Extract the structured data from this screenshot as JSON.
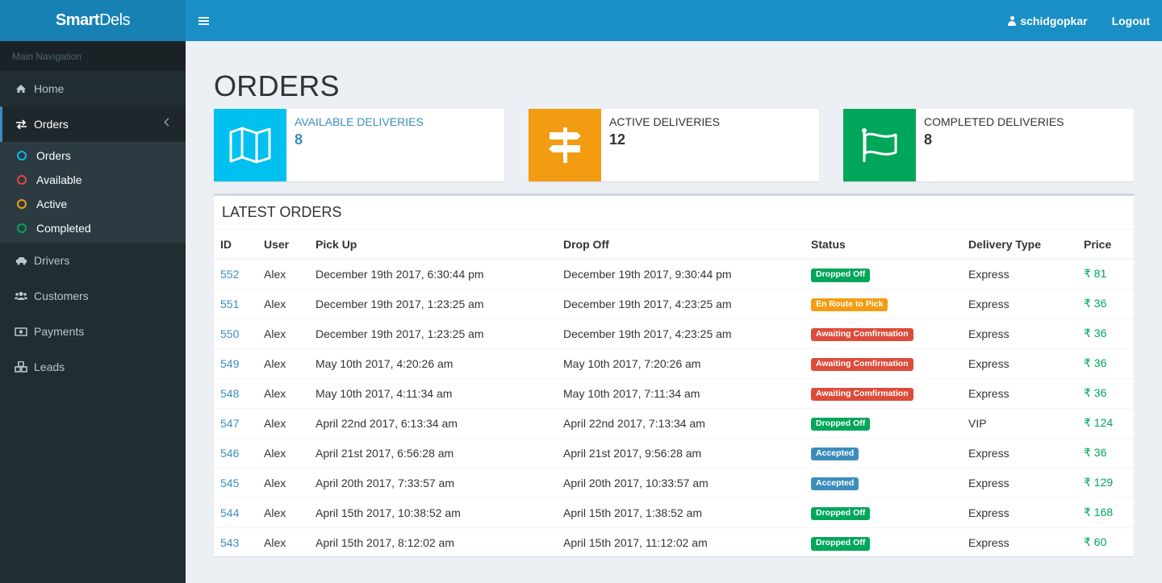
{
  "header": {
    "logo_bold": "Smart",
    "logo_light": "Dels",
    "username": "schidgopkar",
    "logout_label": "Logout"
  },
  "sidebar": {
    "nav_header": "Main Navigation",
    "items": [
      {
        "label": "Home",
        "icon": "home-icon"
      },
      {
        "label": "Orders",
        "icon": "exchange-icon"
      },
      {
        "label": "Drivers",
        "icon": "car-icon"
      },
      {
        "label": "Customers",
        "icon": "users-icon"
      },
      {
        "label": "Payments",
        "icon": "money-icon"
      },
      {
        "label": "Leads",
        "icon": "cubes-icon"
      }
    ],
    "orders_subitems": [
      {
        "label": "Orders",
        "color": "#00c0ef"
      },
      {
        "label": "Available",
        "color": "#dd4b39"
      },
      {
        "label": "Active",
        "color": "#f39c12"
      },
      {
        "label": "Completed",
        "color": "#00a65a"
      }
    ]
  },
  "page": {
    "title": "ORDERS"
  },
  "info_boxes": [
    {
      "label": "AVAILABLE DELIVERIES",
      "value": "8",
      "color": "#00c0ef",
      "icon": "map-icon"
    },
    {
      "label": "ACTIVE DELIVERIES",
      "value": "12",
      "color": "#f39c12",
      "icon": "signpost-icon"
    },
    {
      "label": "COMPLETED DELIVERIES",
      "value": "8",
      "color": "#00a65a",
      "icon": "flag-icon"
    }
  ],
  "latest_orders": {
    "title": "LATEST ORDERS",
    "columns": [
      "ID",
      "User",
      "Pick Up",
      "Drop Off",
      "Status",
      "Delivery Type",
      "Price"
    ],
    "rows": [
      {
        "id": "552",
        "user": "Alex",
        "pickup": "December 19th 2017, 6:30:44 pm",
        "dropoff": "December 19th 2017, 9:30:44 pm",
        "status": "Dropped Off",
        "status_color": "#00a65a",
        "type": "Express",
        "price": "₹ 81"
      },
      {
        "id": "551",
        "user": "Alex",
        "pickup": "December 19th 2017, 1:23:25 am",
        "dropoff": "December 19th 2017, 4:23:25 am",
        "status": "En Route to Pick",
        "status_color": "#f39c12",
        "type": "Express",
        "price": "₹ 36"
      },
      {
        "id": "550",
        "user": "Alex",
        "pickup": "December 19th 2017, 1:23:25 am",
        "dropoff": "December 19th 2017, 4:23:25 am",
        "status": "Awaiting Comfirmation",
        "status_color": "#dd4b39",
        "type": "Express",
        "price": "₹ 36"
      },
      {
        "id": "549",
        "user": "Alex",
        "pickup": "May 10th 2017, 4:20:26 am",
        "dropoff": "May 10th 2017, 7:20:26 am",
        "status": "Awaiting Comfirmation",
        "status_color": "#dd4b39",
        "type": "Express",
        "price": "₹ 36"
      },
      {
        "id": "548",
        "user": "Alex",
        "pickup": "May 10th 2017, 4:11:34 am",
        "dropoff": "May 10th 2017, 7:11:34 am",
        "status": "Awaiting Comfirmation",
        "status_color": "#dd4b39",
        "type": "Express",
        "price": "₹ 36"
      },
      {
        "id": "547",
        "user": "Alex",
        "pickup": "April 22nd 2017, 6:13:34 am",
        "dropoff": "April 22nd 2017, 7:13:34 am",
        "status": "Dropped Off",
        "status_color": "#00a65a",
        "type": "VIP",
        "price": "₹ 124"
      },
      {
        "id": "546",
        "user": "Alex",
        "pickup": "April 21st 2017, 6:56:28 am",
        "dropoff": "April 21st 2017, 9:56:28 am",
        "status": "Accepted",
        "status_color": "#3c8dbc",
        "type": "Express",
        "price": "₹ 36"
      },
      {
        "id": "545",
        "user": "Alex",
        "pickup": "April 20th 2017, 7:33:57 am",
        "dropoff": "April 20th 2017, 10:33:57 am",
        "status": "Accepted",
        "status_color": "#3c8dbc",
        "type": "Express",
        "price": "₹ 129"
      },
      {
        "id": "544",
        "user": "Alex",
        "pickup": "April 15th 2017, 10:38:52 am",
        "dropoff": "April 15th 2017, 1:38:52 am",
        "status": "Dropped Off",
        "status_color": "#00a65a",
        "type": "Express",
        "price": "₹ 168"
      },
      {
        "id": "543",
        "user": "Alex",
        "pickup": "April 15th 2017, 8:12:02 am",
        "dropoff": "April 15th 2017, 11:12:02 am",
        "status": "Dropped Off",
        "status_color": "#00a65a",
        "type": "Express",
        "price": "₹ 60"
      }
    ]
  },
  "colors": {
    "header": "#1a8fc6",
    "logo_bg": "#1781b4",
    "sidebar": "#222d32",
    "link": "#3c8dbc",
    "price": "#00a65a"
  }
}
